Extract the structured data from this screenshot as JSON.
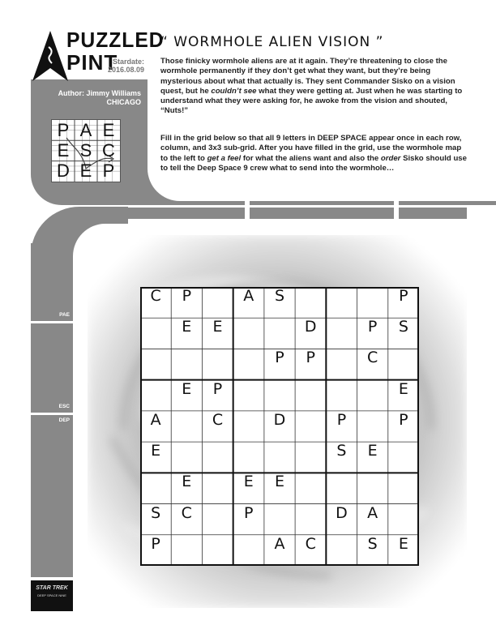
{
  "logo": {
    "word1": "PUZZLED",
    "word2": "PINT",
    "stardate_label": "Stardate:",
    "stardate_value": "2016.08.09"
  },
  "author": {
    "line1": "Author: Jimmy Williams",
    "line2": "CHICAGO"
  },
  "title": "“ WORMHOLE ALIEN VISION ”",
  "intro": "Those finicky wormhole aliens are at it again. They’re threatening to close the wormhole permanently if they don’t get what they want, but they’re being mysterious about what that actually is. They sent Commander Sisko on a vision quest, but he couldn’t see what they were getting at. Just when he was starting to understand what they were asking for, he awoke from the vision and shouted, “Nuts!”",
  "instructions": "Fill in the grid below so that all 9 letters in DEEP SPACE appear once in each row, column, and 3x3 sub-grid. After you have filled in the grid, use the wormhole map to the left to get a feel for what the aliens want and also the order Sisko should use to tell the Deep Space 9 crew what to send into the wormhole…",
  "mini_grid": [
    [
      "P",
      "A",
      "E"
    ],
    [
      "E",
      "S",
      "C"
    ],
    [
      "D",
      "E",
      "P"
    ]
  ],
  "sidebar_labels": [
    "PAE",
    "ESC",
    "DEP"
  ],
  "badge": {
    "line1": "STAR TREK",
    "line2": "DEEP SPACE NINE"
  },
  "grid": [
    [
      "C",
      "P",
      "",
      "A",
      "S",
      "",
      "",
      "",
      "P"
    ],
    [
      "",
      "E",
      "E",
      "",
      "",
      "D",
      "",
      "P",
      "S"
    ],
    [
      "",
      "",
      "",
      "",
      "P",
      "P",
      "",
      "C",
      ""
    ],
    [
      "",
      "E",
      "P",
      "",
      "",
      "",
      "",
      "",
      "E"
    ],
    [
      "A",
      "",
      "C",
      "",
      "D",
      "",
      "P",
      "",
      "P"
    ],
    [
      "E",
      "",
      "",
      "",
      "",
      "",
      "S",
      "E",
      ""
    ],
    [
      "",
      "E",
      "",
      "E",
      "E",
      "",
      "",
      "",
      ""
    ],
    [
      "S",
      "C",
      "",
      "P",
      "",
      "",
      "D",
      "A",
      ""
    ],
    [
      "P",
      "",
      "",
      "",
      "A",
      "C",
      "",
      "S",
      "E"
    ]
  ]
}
